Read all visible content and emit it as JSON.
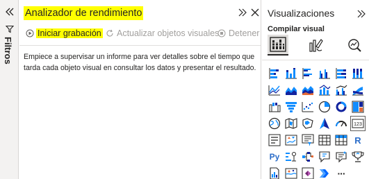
{
  "filters": {
    "label": "Filtros",
    "expand_icon": "chevron-double-left-icon",
    "filter_icon": "funnel-icon"
  },
  "performance_analyzer": {
    "title": "Analizador de rendimiento",
    "toolbar": {
      "start_recording": "Iniciar grabación",
      "refresh_visuals": "Actualizar objetos visuales",
      "stop": "Detener"
    },
    "description": "Empiece a supervisar un informe para ver detalles sobre el tiempo que tarda cada objeto visual en consultar los datos y presentar el resultado."
  },
  "visualizations": {
    "title": "Visualizaciones",
    "build_visual_label": "Compilar visual",
    "tabs": [
      "build-visual-icon",
      "format-visual-icon",
      "analytics-icon"
    ],
    "icons": [
      "stacked-bar-chart-icon",
      "stacked-column-chart-icon",
      "clustered-bar-chart-icon",
      "clustered-column-chart-icon",
      "100-stacked-bar-chart-icon",
      "100-stacked-column-chart-icon",
      "line-chart-icon",
      "area-chart-icon",
      "stacked-area-chart-icon",
      "line-and-stacked-column-chart-icon",
      "line-and-clustered-column-chart-icon",
      "ribbon-chart-icon",
      "waterfall-chart-icon",
      "funnel-chart-icon",
      "scatter-chart-icon",
      "pie-chart-icon",
      "donut-chart-icon",
      "treemap-icon",
      "map-icon",
      "filled-map-icon",
      "shape-map-icon",
      "azure-map-icon",
      "gauge-icon",
      "card-icon",
      "multi-row-card-icon",
      "kpi-icon",
      "slicer-icon",
      "table-icon",
      "matrix-icon",
      "r-script-visual-icon",
      "python-visual-icon",
      "key-influencers-icon",
      "decomposition-tree-icon",
      "qa-icon",
      "smart-narrative-icon",
      "metrics-icon",
      "paginated-report-icon",
      "arcgis-map-icon",
      "power-apps-icon",
      "power-automate-icon",
      "more-visuals-icon"
    ],
    "r_label": "R",
    "py_label": "Py",
    "card_label": "123",
    "more_label": "···",
    "accent": "#118dff"
  },
  "colors": {
    "highlight": "#ffff00",
    "text": "#252423",
    "disabled": "#a19f9d",
    "pane_bg": "#f3f2f1"
  }
}
